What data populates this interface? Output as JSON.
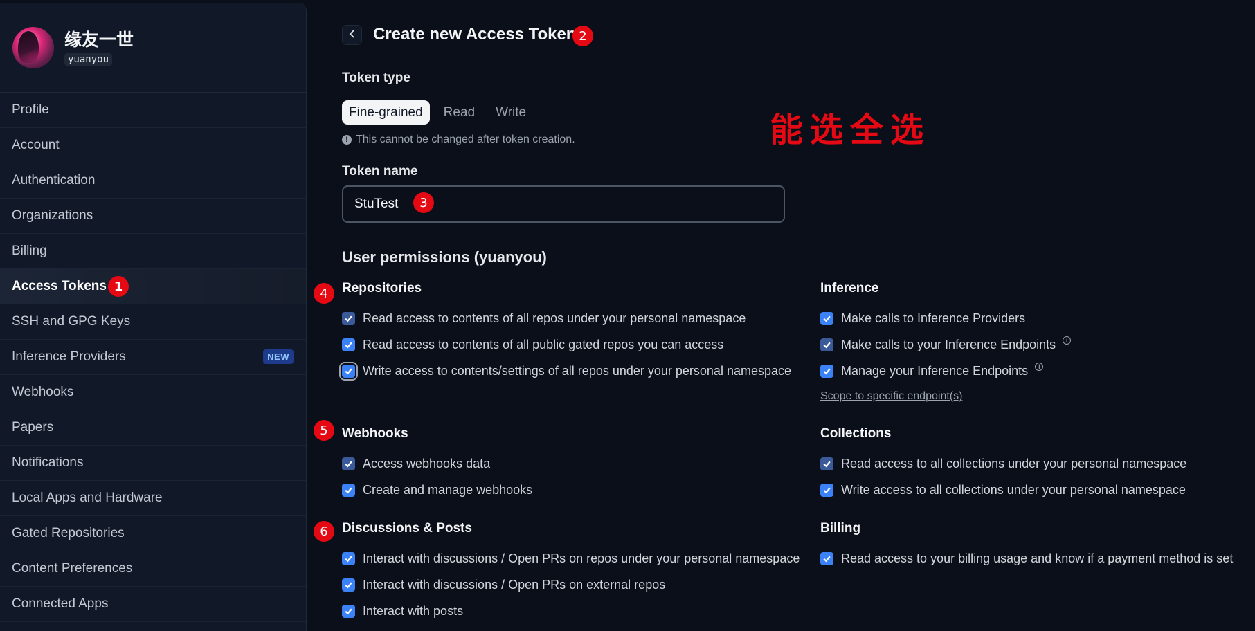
{
  "profile": {
    "display_name": "缘友一世",
    "username": "yuanyou"
  },
  "sidebar": {
    "items": [
      {
        "label": "Profile"
      },
      {
        "label": "Account"
      },
      {
        "label": "Authentication"
      },
      {
        "label": "Organizations"
      },
      {
        "label": "Billing"
      },
      {
        "label": "Access Tokens",
        "active": true
      },
      {
        "label": "SSH and GPG Keys"
      },
      {
        "label": "Inference Providers",
        "badge": "NEW"
      },
      {
        "label": "Webhooks"
      },
      {
        "label": "Papers"
      },
      {
        "label": "Notifications"
      },
      {
        "label": "Local Apps and Hardware"
      },
      {
        "label": "Gated Repositories"
      },
      {
        "label": "Content Preferences"
      },
      {
        "label": "Connected Apps"
      }
    ]
  },
  "header": {
    "back_icon": "chevron-left-icon",
    "title": "Create new Access Token"
  },
  "token_type": {
    "label": "Token type",
    "options": [
      "Fine-grained",
      "Read",
      "Write"
    ],
    "selected": "Fine-grained",
    "hint": "This cannot be changed after token creation."
  },
  "token_name": {
    "label": "Token name",
    "value": "StuTest"
  },
  "permissions": {
    "title": "User permissions (yuanyou)",
    "repositories": {
      "title": "Repositories",
      "items": [
        "Read access to contents of all repos under your personal namespace",
        "Read access to contents of all public gated repos you can access",
        "Write access to contents/settings of all repos under your personal namespace"
      ]
    },
    "inference": {
      "title": "Inference",
      "items": [
        "Make calls to Inference Providers",
        "Make calls to your Inference Endpoints",
        "Manage your Inference Endpoints"
      ],
      "link": "Scope to specific endpoint(s)"
    },
    "webhooks": {
      "title": "Webhooks",
      "items": [
        "Access webhooks data",
        "Create and manage webhooks"
      ]
    },
    "collections": {
      "title": "Collections",
      "items": [
        "Read access to all collections under your personal namespace",
        "Write access to all collections under your personal namespace"
      ]
    },
    "discussions": {
      "title": "Discussions & Posts",
      "items": [
        "Interact with discussions / Open PRs on repos under your personal namespace",
        "Interact with discussions / Open PRs on external repos",
        "Interact with posts"
      ]
    },
    "billing": {
      "title": "Billing",
      "items": [
        "Read access to your billing usage and know if a payment method is set"
      ]
    }
  },
  "annotations": {
    "markers": [
      "1",
      "2",
      "3",
      "4",
      "5",
      "6"
    ],
    "note": "能选全选"
  },
  "colors": {
    "background": "#0b0f19",
    "sidebar": "#111827",
    "checkbox": "#3b82f6",
    "marker": "#e50914"
  }
}
